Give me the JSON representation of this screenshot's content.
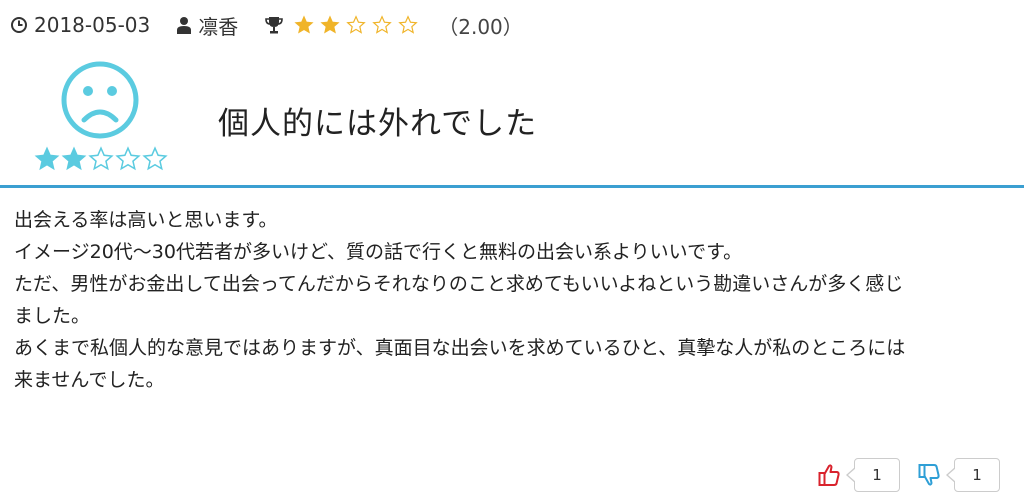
{
  "review": {
    "date": "2018-05-03",
    "author": "凛香",
    "score_text": "（2.00）",
    "rating": 2,
    "max_rating": 5,
    "title": "個人的には外れでした",
    "body_lines": [
      "出会える率は高いと思います。",
      "イメージ20代〜30代若者が多いけど、質の話で行くと無料の出会い系よりいいです。",
      "ただ、男性がお金出して出会ってんだからそれなりのこと求めてもいいよねという勘違いさんが多く感じ",
      "ました。",
      "あくまで私個人的な意見ではありますが、真面目な出会いを求めているひと、真摯な人が私のところには",
      "来ませんでした。"
    ]
  },
  "votes": {
    "up_count": "1",
    "down_count": "1"
  },
  "colors": {
    "star_gold": "#f0b429",
    "face_blue": "#5bcbe0",
    "divider": "#3b9fd1",
    "thumb_up": "#d9232d",
    "thumb_down": "#2f9fd6"
  },
  "icons": {
    "date": "clock-icon",
    "author": "user-icon",
    "rating": "trophy-icon",
    "face": "sad-face-icon",
    "up": "thumbs-up-icon",
    "down": "thumbs-down-icon"
  }
}
